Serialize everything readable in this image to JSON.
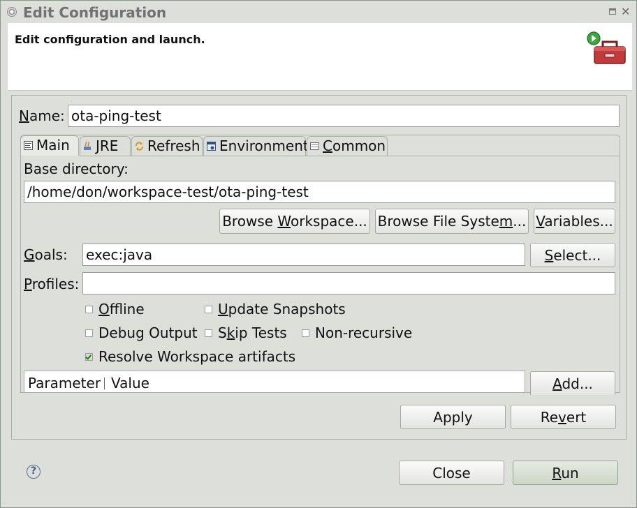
{
  "window": {
    "title": "Edit Configuration",
    "banner_message": "Edit configuration and launch."
  },
  "name_field": {
    "label": "Name:",
    "value": "ota-ping-test"
  },
  "tabs": [
    {
      "label": "Main",
      "icon": "main-tab-icon",
      "active": true
    },
    {
      "label": "JRE",
      "icon": "jre-icon",
      "active": false
    },
    {
      "label": "Refresh",
      "icon": "refresh-icon",
      "active": false
    },
    {
      "label": "Environment",
      "icon": "environment-icon",
      "active": false
    },
    {
      "label": "Common",
      "icon": "common-icon",
      "active": false
    }
  ],
  "main": {
    "base_directory_label": "Base directory:",
    "base_directory_value": "/home/don/workspace-test/ota-ping-test",
    "browse_workspace_label": "Browse Workspace...",
    "browse_filesystem_label": "Browse File System...",
    "variables_label": "Variables...",
    "goals_label": "Goals:",
    "goals_value": "exec:java",
    "select_label": "Select...",
    "profiles_label": "Profiles:",
    "profiles_value": "",
    "checkboxes": [
      {
        "label": "Offline",
        "checked": false
      },
      {
        "label": "Update Snapshots",
        "checked": false
      },
      {
        "label": "Debug Output",
        "checked": false
      },
      {
        "label": "Skip Tests",
        "checked": false
      },
      {
        "label": "Non-recursive",
        "checked": false
      },
      {
        "label": "Resolve Workspace artifacts",
        "checked": true
      }
    ],
    "param_table": {
      "columns": [
        "Parameter",
        "Value"
      ]
    },
    "add_label": "Add..."
  },
  "actions": {
    "apply_label": "Apply",
    "revert_label": "Revert",
    "close_label": "Close",
    "run_label": "Run"
  },
  "colors": {
    "window_bg": "#dcdfda",
    "checkbox_check": "#2f6b2a",
    "toolbox_red": "#c23a3a",
    "run_badge_green": "#3aa83a"
  }
}
